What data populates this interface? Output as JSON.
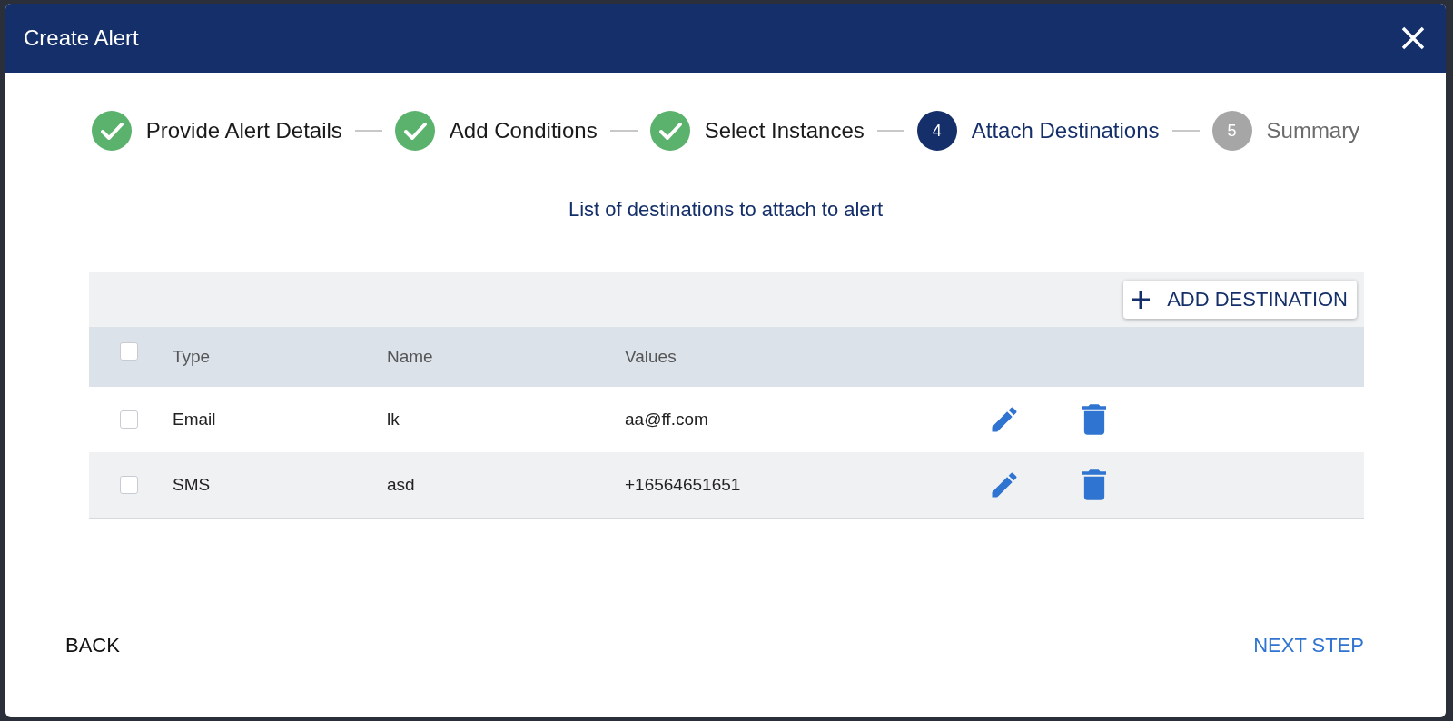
{
  "window": {
    "title": "Create Alert"
  },
  "steps": [
    {
      "label": "Provide Alert Details",
      "kind": "done"
    },
    {
      "label": "Add Conditions",
      "kind": "done"
    },
    {
      "label": "Select Instances",
      "kind": "done"
    },
    {
      "number": "4",
      "label": "Attach Destinations",
      "kind": "active"
    },
    {
      "number": "5",
      "label": "Summary",
      "kind": "pending"
    }
  ],
  "subtitle": "List of destinations to attach to alert",
  "add_button": {
    "label": "ADD DESTINATION"
  },
  "table": {
    "select_all": {
      "checked": false
    },
    "columns": [
      "Type",
      "Name",
      "Values"
    ],
    "rows": [
      {
        "checked": false,
        "cells": [
          "Email",
          "lk",
          "aa@ff.com"
        ]
      },
      {
        "checked": false,
        "cells": [
          "SMS",
          "asd",
          "+16564651651"
        ]
      }
    ]
  },
  "footer": {
    "back": "BACK",
    "next": "NEXT STEP"
  }
}
